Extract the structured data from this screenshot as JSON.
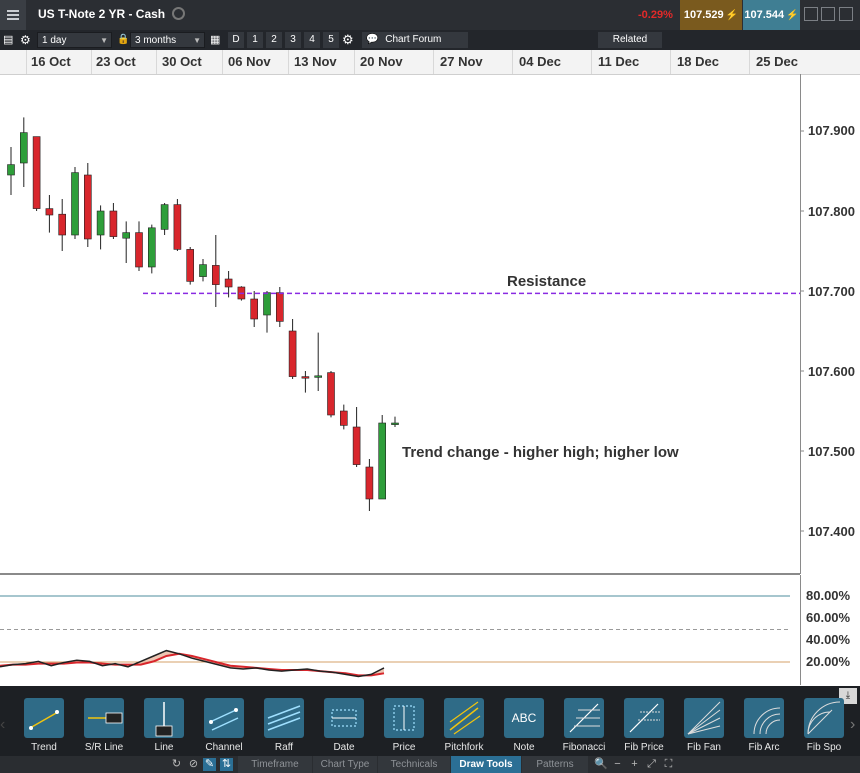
{
  "header": {
    "title": "US T-Note 2 YR - Cash",
    "change": "-0.29%",
    "bid": "107.529",
    "ask": "107.544"
  },
  "toolbar": {
    "interval": "1 day",
    "range": "3 months",
    "periods": [
      "D",
      "1",
      "2",
      "3",
      "4",
      "5"
    ],
    "forum_label": "Chart Forum",
    "related_label": "Related"
  },
  "dates": [
    "16 Oct",
    "23 Oct",
    "30 Oct",
    "06 Nov",
    "13 Nov",
    "20 Nov",
    "27 Nov",
    "04 Dec",
    "11 Dec",
    "18 Dec",
    "25 Dec"
  ],
  "chart": {
    "price_ticks": [
      "107.900",
      "107.800",
      "107.700",
      "107.600",
      "107.500",
      "107.400"
    ],
    "resistance_label": "Resistance",
    "resistance_level": 107.697,
    "trend_label": "Trend change - higher high; higher low",
    "osc_ticks": [
      "80.00%",
      "60.00%",
      "40.00%",
      "20.00%"
    ],
    "colors": {
      "up": "#2e9e3a",
      "down": "#d8262c",
      "resistance": "#8a2be2"
    }
  },
  "chart_data": {
    "type": "candlestick",
    "y_range": [
      107.345,
      107.97
    ],
    "candles": [
      {
        "o": 107.845,
        "h": 107.88,
        "l": 107.82,
        "c": 107.858
      },
      {
        "o": 107.86,
        "h": 107.917,
        "l": 107.83,
        "c": 107.898
      },
      {
        "o": 107.893,
        "h": 107.893,
        "l": 107.8,
        "c": 107.803
      },
      {
        "o": 107.803,
        "h": 107.82,
        "l": 107.773,
        "c": 107.795
      },
      {
        "o": 107.796,
        "h": 107.815,
        "l": 107.75,
        "c": 107.77
      },
      {
        "o": 107.77,
        "h": 107.855,
        "l": 107.765,
        "c": 107.848
      },
      {
        "o": 107.845,
        "h": 107.86,
        "l": 107.755,
        "c": 107.765
      },
      {
        "o": 107.77,
        "h": 107.807,
        "l": 107.752,
        "c": 107.8
      },
      {
        "o": 107.8,
        "h": 107.81,
        "l": 107.765,
        "c": 107.768
      },
      {
        "o": 107.766,
        "h": 107.787,
        "l": 107.735,
        "c": 107.773
      },
      {
        "o": 107.773,
        "h": 107.787,
        "l": 107.725,
        "c": 107.73
      },
      {
        "o": 107.73,
        "h": 107.783,
        "l": 107.722,
        "c": 107.779
      },
      {
        "o": 107.777,
        "h": 107.81,
        "l": 107.77,
        "c": 107.808
      },
      {
        "o": 107.808,
        "h": 107.815,
        "l": 107.75,
        "c": 107.752
      },
      {
        "o": 107.752,
        "h": 107.755,
        "l": 107.708,
        "c": 107.712
      },
      {
        "o": 107.718,
        "h": 107.74,
        "l": 107.712,
        "c": 107.733
      },
      {
        "o": 107.732,
        "h": 107.77,
        "l": 107.68,
        "c": 107.708
      },
      {
        "o": 107.715,
        "h": 107.725,
        "l": 107.692,
        "c": 107.705
      },
      {
        "o": 107.705,
        "h": 107.706,
        "l": 107.688,
        "c": 107.69
      },
      {
        "o": 107.69,
        "h": 107.7,
        "l": 107.655,
        "c": 107.665
      },
      {
        "o": 107.67,
        "h": 107.7,
        "l": 107.648,
        "c": 107.698
      },
      {
        "o": 107.698,
        "h": 107.705,
        "l": 107.655,
        "c": 107.662
      },
      {
        "o": 107.65,
        "h": 107.665,
        "l": 107.59,
        "c": 107.593
      },
      {
        "o": 107.593,
        "h": 107.6,
        "l": 107.573,
        "c": 107.591
      },
      {
        "o": 107.592,
        "h": 107.648,
        "l": 107.575,
        "c": 107.594
      },
      {
        "o": 107.598,
        "h": 107.6,
        "l": 107.542,
        "c": 107.545
      },
      {
        "o": 107.55,
        "h": 107.558,
        "l": 107.527,
        "c": 107.532
      },
      {
        "o": 107.53,
        "h": 107.555,
        "l": 107.48,
        "c": 107.483
      },
      {
        "o": 107.48,
        "h": 107.49,
        "l": 107.425,
        "c": 107.44
      },
      {
        "o": 107.44,
        "h": 107.545,
        "l": 107.44,
        "c": 107.535
      },
      {
        "o": 107.533,
        "h": 107.543,
        "l": 107.53,
        "c": 107.535
      }
    ],
    "oscillator": {
      "y_range": [
        0,
        100
      ],
      "levels": [
        80,
        50,
        20
      ],
      "k": [
        15,
        17,
        18,
        20,
        16,
        19,
        21,
        20,
        16,
        18,
        15,
        20,
        25,
        30,
        27,
        23,
        20,
        17,
        14,
        13,
        14,
        12,
        11,
        12,
        13,
        11,
        10,
        8,
        6,
        8,
        14
      ],
      "d": [
        16,
        17,
        17,
        18,
        18,
        18,
        19,
        19,
        18,
        17,
        17,
        17,
        20,
        25,
        27,
        25,
        22,
        19,
        16,
        15,
        14,
        13,
        12,
        12,
        12,
        11,
        10,
        9,
        7,
        7,
        9
      ]
    }
  },
  "draw_tools": [
    {
      "label": "Trend",
      "icon": "trend-line-icon"
    },
    {
      "label": "S/R Line",
      "icon": "sr-line-icon"
    },
    {
      "label": "Line",
      "icon": "vertical-line-icon"
    },
    {
      "label": "Channel",
      "icon": "channel-icon"
    },
    {
      "label": "Raff",
      "icon": "raff-channel-icon"
    },
    {
      "label": "Date",
      "icon": "date-range-icon"
    },
    {
      "label": "Price",
      "icon": "price-range-icon"
    },
    {
      "label": "Pitchfork",
      "icon": "pitchfork-icon"
    },
    {
      "label": "Note",
      "icon": "note-icon"
    },
    {
      "label": "Fibonacci",
      "icon": "fibonacci-icon"
    },
    {
      "label": "Fib Price",
      "icon": "fib-price-icon"
    },
    {
      "label": "Fib Fan",
      "icon": "fib-fan-icon"
    },
    {
      "label": "Fib Arc",
      "icon": "fib-arc-icon"
    },
    {
      "label": "Fib Spo",
      "icon": "fib-spiral-icon"
    }
  ],
  "note_icon_text": "ABC",
  "tabs": [
    "Timeframe",
    "Chart Type",
    "Technicals",
    "Draw Tools",
    "Patterns"
  ]
}
